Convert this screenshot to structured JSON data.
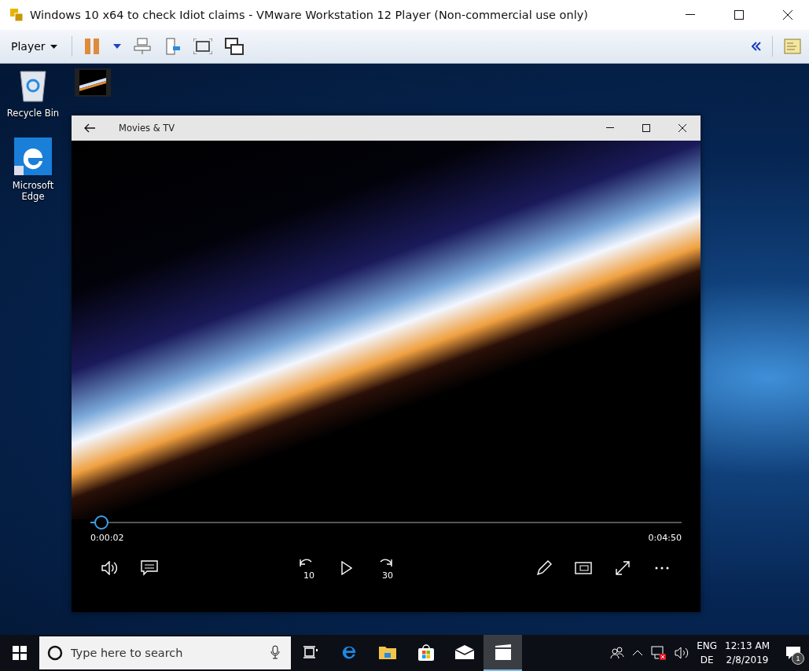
{
  "window": {
    "title": "Windows 10 x64 to check Idiot claims - VMware Workstation 12 Player (Non-commercial use only)"
  },
  "toolbar": {
    "menu": "Player"
  },
  "desktop_icons": [
    {
      "kind": "recycle",
      "label": "Recycle Bin"
    },
    {
      "kind": "video"
    },
    {
      "kind": "edge",
      "label": "Microsoft Edge"
    }
  ],
  "player": {
    "title": "Movies & TV",
    "level": 0.018,
    "elapsed": "0:00:02",
    "duration": "0:04:50",
    "skip_back": "10",
    "skip_forward": "30"
  },
  "taskbar": {
    "search": {
      "placeholder": "Type here to search"
    },
    "apps": [
      {
        "kind": "taskview",
        "selected": false
      },
      {
        "kind": "edge",
        "selected": false
      },
      {
        "kind": "explorer",
        "selected": false
      },
      {
        "kind": "store",
        "selected": false
      },
      {
        "kind": "mail",
        "selected": false
      },
      {
        "kind": "movies",
        "selected": true
      }
    ],
    "language": "ENG",
    "layout": "DE",
    "time": "12:13 AM",
    "date": "2/8/2019",
    "notifications": "1"
  }
}
